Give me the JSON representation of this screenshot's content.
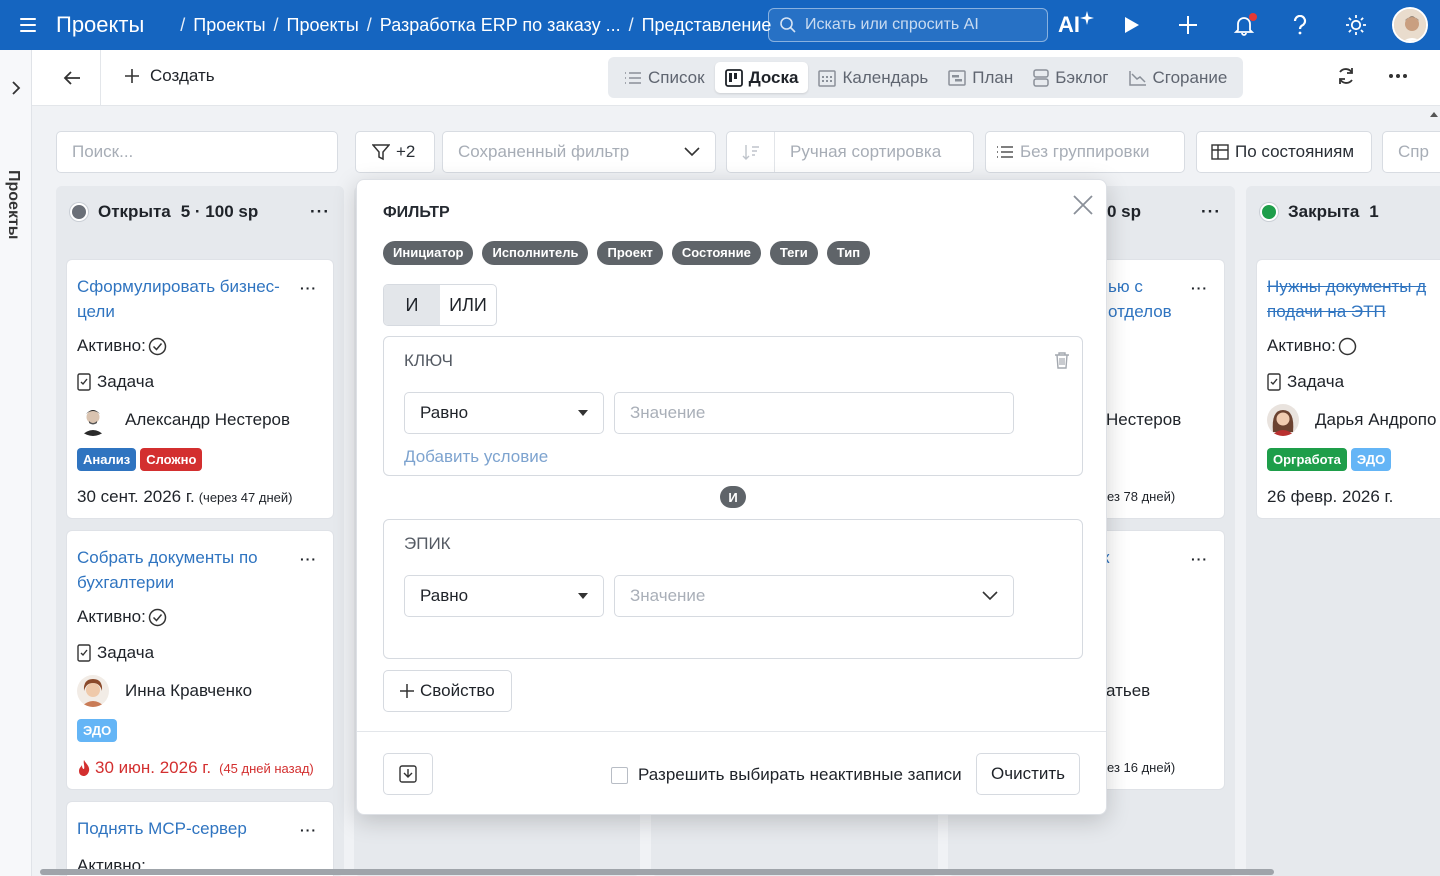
{
  "app": {
    "title": "Проекты"
  },
  "breadcrumbs": [
    "Проекты",
    "Проекты",
    "Разработка ERP по заказу ...",
    "Представление"
  ],
  "search": {
    "placeholder": "Искать или спросить AI"
  },
  "top_icons": {
    "ai": "AI"
  },
  "rail": {
    "label": "Проекты"
  },
  "toolbar": {
    "create_label": "Создать",
    "views": [
      {
        "label": "Список",
        "icon": "list-icon"
      },
      {
        "label": "Доска",
        "icon": "board-icon",
        "active": true
      },
      {
        "label": "Календарь",
        "icon": "calendar-icon"
      },
      {
        "label": "План",
        "icon": "plan-icon"
      },
      {
        "label": "Бэклог",
        "icon": "backlog-icon"
      },
      {
        "label": "Сгорание",
        "icon": "burndown-icon"
      }
    ]
  },
  "filterbar": {
    "search_placeholder": "Поиск...",
    "filter_count": "+2",
    "saved_filter_placeholder": "Сохраненный фильтр",
    "sort_placeholder": "Ручная сортировка",
    "grouping_placeholder": "Без группировки",
    "by_state": "По состояниям",
    "more": "Спр"
  },
  "columns": {
    "open": {
      "name": "Открыта",
      "stats": "5 · 100 sp",
      "color": "#6b7078"
    },
    "middle": {
      "stats": "0 sp"
    },
    "closed": {
      "name": "Закрыта",
      "count": "1",
      "color": "#1e9e4a"
    }
  },
  "cards": {
    "c1": {
      "title": "Сформулировать бизнес-цели",
      "active_label": "Активно:",
      "type": "Задача",
      "assignee": "Александр Нестеров",
      "tags": [
        {
          "label": "Анализ",
          "color": "#2f74c0"
        },
        {
          "label": "Сложно",
          "color": "#d32f2f"
        }
      ],
      "date": "30 сент. 2026 г.",
      "date_note": "(через 47 дней)"
    },
    "c2": {
      "title": "Собрать документы по бухгалтерии",
      "active_label": "Активно:",
      "type": "Задача",
      "assignee": "Инна Кравченко",
      "tags": [
        {
          "label": "ЭДО",
          "color": "#64b5f6"
        }
      ],
      "date": "30 июн. 2026 г.",
      "date_note": "(45 дней назад)",
      "overdue_color": "#d32f2f"
    },
    "c3": {
      "title": "Поднять MCP-сервер",
      "active_label": "Активно:"
    },
    "m1": {
      "title_frag1": "ью с",
      "title_frag2": "отделов",
      "assignee_frag": "Нестеров",
      "date_note_frag": "ез 78 дней)"
    },
    "m2": {
      "title_frag": "к",
      "assignee_frag": "атьев",
      "date_note_frag": "ез 16 дней)"
    },
    "r1": {
      "title": "Нужны документы для подачи на ЭТП",
      "title_line1": "Нужны документы д",
      "title_line2": "подачи на ЭТП",
      "active_label": "Активно:",
      "type": "Задача",
      "assignee": "Дарья Андропо",
      "tags": [
        {
          "label": "Оргработа",
          "color": "#1e9e4a"
        },
        {
          "label": "ЭДО",
          "color": "#64b5f6"
        }
      ],
      "date": "26 февр. 2026 г."
    }
  },
  "filter_modal": {
    "title": "ФИЛЬТР",
    "chips": [
      "Инициатор",
      "Исполнитель",
      "Проект",
      "Состояние",
      "Теги",
      "Тип"
    ],
    "logic": {
      "and": "И",
      "or": "ИЛИ",
      "selected": "И"
    },
    "conditions": [
      {
        "title": "КЛЮЧ",
        "operator": "Равно",
        "value_placeholder": "Значение",
        "add_label": "Добавить условие"
      },
      {
        "title": "ЭПИК",
        "operator": "Равно",
        "value_placeholder": "Значение"
      }
    ],
    "join_label": "И",
    "add_property": "Свойство",
    "allow_inactive": "Разрешить выбирать неактивные записи",
    "clear": "Очистить"
  }
}
